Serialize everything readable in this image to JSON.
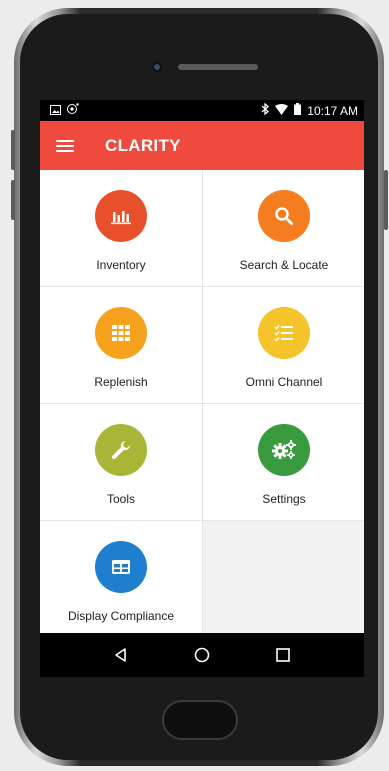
{
  "status_bar": {
    "time": "10:17 AM",
    "icons": [
      "image-icon",
      "notification-icon",
      "bluetooth-icon",
      "wifi-icon",
      "battery-icon"
    ]
  },
  "app_bar": {
    "title": "CLARITY",
    "color": "#f04a3e"
  },
  "tiles": [
    {
      "label": "Inventory",
      "icon": "bar-chart-icon",
      "color": "#e8502c"
    },
    {
      "label": "Search & Locate",
      "icon": "search-icon",
      "color": "#f57c1f"
    },
    {
      "label": "Replenish",
      "icon": "grid-icon",
      "color": "#f7a21d"
    },
    {
      "label": "Omni Channel",
      "icon": "checklist-icon",
      "color": "#f5c32a"
    },
    {
      "label": "Tools",
      "icon": "wrench-icon",
      "color": "#a9b536"
    },
    {
      "label": "Settings",
      "icon": "gears-icon",
      "color": "#3a9a3e"
    },
    {
      "label": "Display Compliance",
      "icon": "table-icon",
      "color": "#1f7fcf"
    }
  ],
  "nav_bar": {
    "buttons": [
      "back-icon",
      "home-icon",
      "recents-icon"
    ]
  }
}
